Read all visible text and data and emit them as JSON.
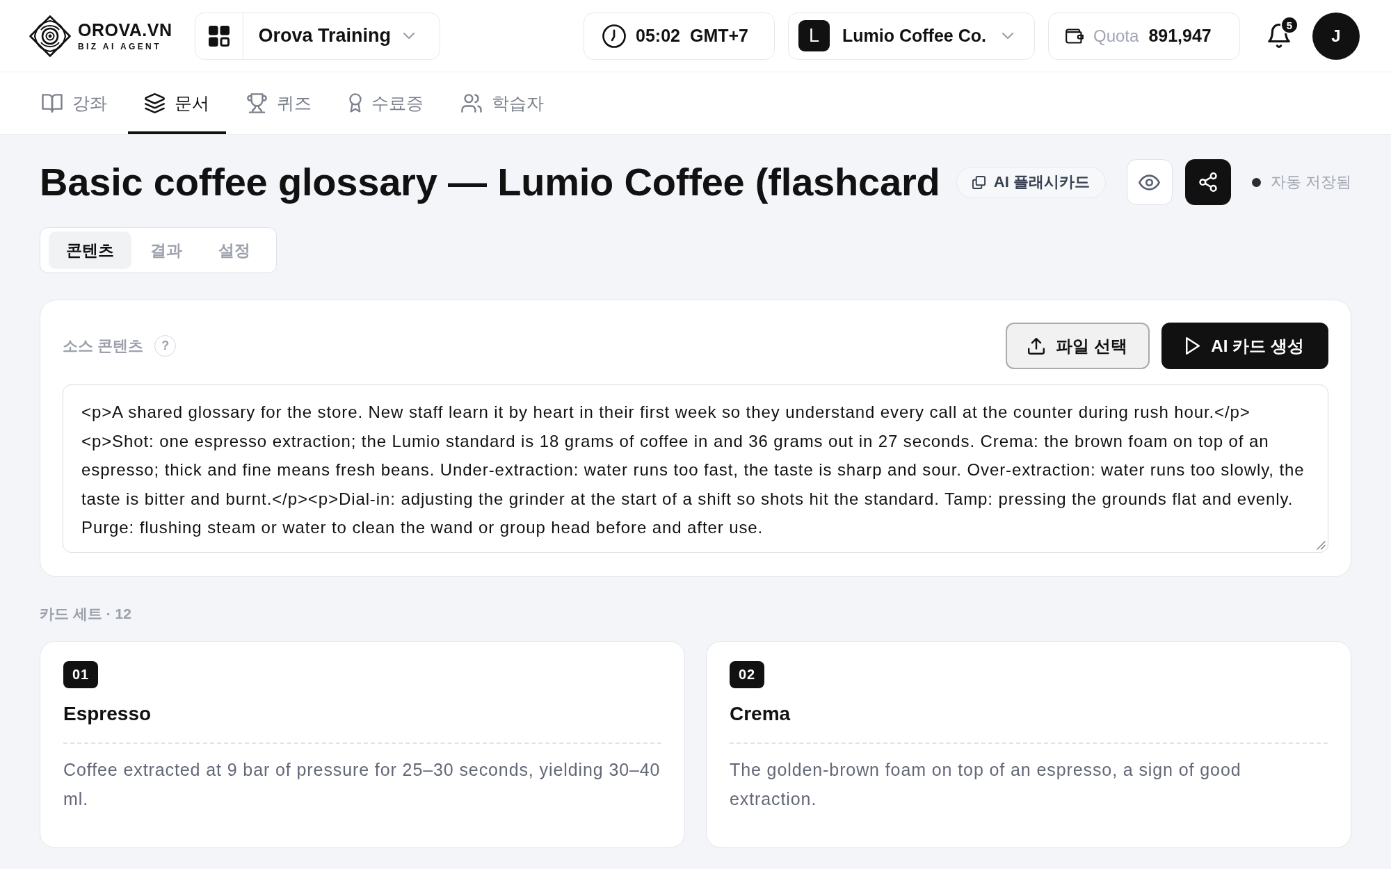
{
  "header": {
    "logo": {
      "wordmark": "OROVA.VN",
      "tagline": "BIZ AI AGENT"
    },
    "workspace": {
      "name": "Orova Training"
    },
    "clock": {
      "time": "05:02",
      "timezone": "GMT+7"
    },
    "company": {
      "initial": "L",
      "name": "Lumio Coffee Co."
    },
    "quota": {
      "label": "Quota",
      "value": "891,947"
    },
    "notifications": {
      "count": "5"
    },
    "user": {
      "initial": "J"
    }
  },
  "nav_tabs": [
    {
      "label": "강좌",
      "selected": false
    },
    {
      "label": "문서",
      "selected": true
    },
    {
      "label": "퀴즈",
      "selected": false
    },
    {
      "label": "수료증",
      "selected": false
    },
    {
      "label": "학습자",
      "selected": false
    }
  ],
  "document": {
    "title": "Basic coffee glossary — Lumio Coffee (flashcard",
    "type_badge": "AI 플래시카드",
    "autosave_status": "자동 저장됨"
  },
  "view_tabs": [
    {
      "label": "콘텐츠",
      "selected": true
    },
    {
      "label": "결과",
      "selected": false
    },
    {
      "label": "설정",
      "selected": false
    }
  ],
  "source": {
    "label": "소스 콘텐츠",
    "help": "?",
    "buttons": [
      {
        "label": "파일 선택",
        "kind": "upload"
      },
      {
        "label": "AI 카드 생성",
        "kind": "generate"
      }
    ],
    "content": "<p>A shared glossary for the store. New staff learn it by heart in their first week so they understand every call at the counter during rush hour.</p><p>Shot: one espresso extraction; the Lumio standard is 18 grams of coffee in and 36 grams out in 27 seconds. Crema: the brown foam on top of an espresso; thick and fine means fresh beans. Under-extraction: water runs too fast, the taste is sharp and sour. Over-extraction: water runs too slowly, the taste is bitter and burnt.</p><p>Dial-in: adjusting the grinder at the start of a shift so shots hit the standard. Tamp: pressing the grounds flat and evenly. Purge: flushing steam or water to clean the wand or group head before and after use."
  },
  "card_set": {
    "label": "카드 세트 · 12",
    "cards": [
      {
        "number": "01",
        "term": "Espresso",
        "definition": "Coffee extracted at 9 bar of pressure for 25–30 seconds, yielding 30–40 ml."
      },
      {
        "number": "02",
        "term": "Crema",
        "definition": "The golden-brown foam on top of an espresso, a sign of good extraction."
      }
    ]
  }
}
